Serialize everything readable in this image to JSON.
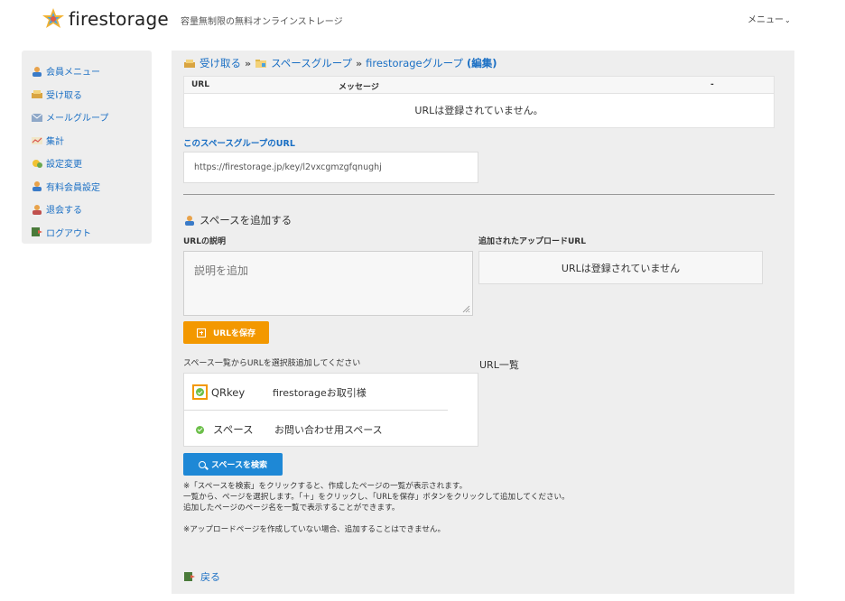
{
  "header": {
    "logo_text": "firestorage",
    "tagline": "容量無制限の無料オンラインストレージ",
    "menu_label": "メニュー"
  },
  "sidebar": {
    "items": [
      {
        "label": "会員メニュー",
        "icon": "member-icon"
      },
      {
        "label": "受け取る",
        "icon": "receive-icon"
      },
      {
        "label": "メールグループ",
        "icon": "mail-group-icon"
      },
      {
        "label": "集計",
        "icon": "stats-icon"
      },
      {
        "label": "設定変更",
        "icon": "settings-icon"
      },
      {
        "label": "有料会員設定",
        "icon": "paid-member-icon"
      },
      {
        "label": "退会する",
        "icon": "withdraw-icon"
      },
      {
        "label": "ログアウト",
        "icon": "logout-icon"
      }
    ]
  },
  "breadcrumb": {
    "receive": "受け取る",
    "space_group": "スペースグループ",
    "current": "firestorageグループ",
    "edit": "(編集)"
  },
  "url_table": {
    "headers": [
      "URL",
      "メッセージ",
      "-"
    ],
    "empty_message": "URLは登録されていません。"
  },
  "space_group_url": {
    "title": "このスペースグループのURL",
    "value": "https://firestorage.jp/key/l2vxcgmzgfqnughj"
  },
  "add_space": {
    "title": "スペースを追加する",
    "desc_label": "URLの説明",
    "desc_placeholder": "説明を追加",
    "uploaded_label": "追加されたアップロードURL",
    "uploaded_empty": "URLは登録されていません",
    "save_button": "URLを保存",
    "select_hint": "スペース一覧からURLを選択肢追加してください",
    "url_list_title": "URL一覧",
    "spaces": [
      {
        "name": "QRkey",
        "client": "firestorageお取引様",
        "checked": true
      },
      {
        "name": "スペース",
        "client": "お問い合わせ用スペース",
        "checked": true
      }
    ],
    "search_button": "スペースを検索"
  },
  "notes": {
    "line1": "※「スペースを検索」をクリックすると、作成したページの一覧が表示されます。",
    "line2": "一覧から、ページを選択します。「＋」をクリックし、「URLを保存」ボタンをクリックして追加してください。",
    "line3": "追加したページのページ名を一覧で表示することができます。",
    "line4": "※アップロードページを作成していない場合、追加することはできません。"
  },
  "back_link": "戻る",
  "colors": {
    "accent_blue": "#1a6fc4",
    "button_blue": "#1e88d6",
    "button_orange": "#f39800",
    "check_green": "#6cbf4a",
    "panel_gray": "#eeeeee"
  }
}
